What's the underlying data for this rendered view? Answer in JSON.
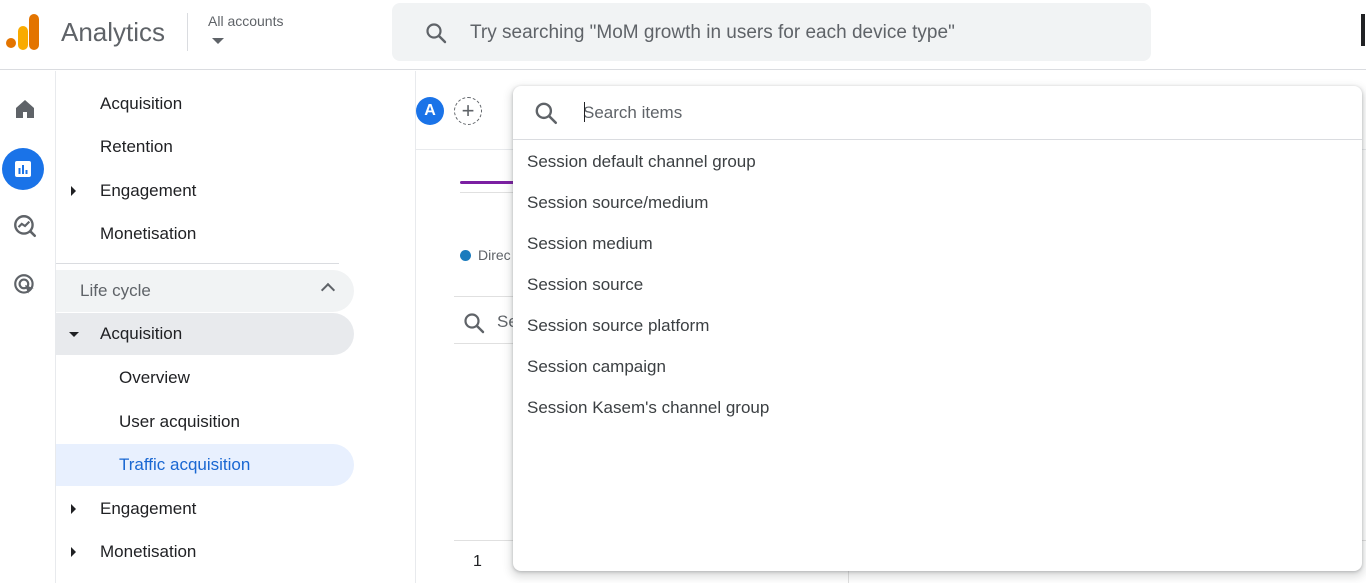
{
  "header": {
    "app_title": "Analytics",
    "accounts_label": "All accounts",
    "search_placeholder": "Try searching \"MoM growth in users for each device type\""
  },
  "sidebar": {
    "items_top": [
      {
        "label": "Acquisition"
      },
      {
        "label": "Retention"
      },
      {
        "label": "Engagement"
      },
      {
        "label": "Monetisation"
      }
    ],
    "lifecycle_label": "Life cycle",
    "lifecycle_acquisition": "Acquisition",
    "sub_items": [
      {
        "label": "Overview"
      },
      {
        "label": "User acquisition"
      },
      {
        "label": "Traffic acquisition"
      }
    ],
    "engagement": "Engagement",
    "monetisation": "Monetisation"
  },
  "main": {
    "segment_avatar": "A",
    "add_symbol": "+",
    "legend_text": "Direc",
    "table_search_text": "Se",
    "row_number": "1"
  },
  "dropdown": {
    "search_placeholder": "Search items",
    "items": [
      "Session default channel group",
      "Session source/medium",
      "Session medium",
      "Session source",
      "Session source platform",
      "Session campaign",
      "Session Kasem's channel group"
    ]
  },
  "icons": {
    "top_search": "search-icon",
    "rail": [
      "home-icon",
      "reports-icon",
      "explore-icon",
      "advertising-icon"
    ],
    "dropdown_search": "search-icon"
  },
  "colors": {
    "accent": "#1a73e8",
    "selected_bg": "#e8f0fe",
    "logo_orange": "#e37400",
    "logo_yellow": "#f9ab00",
    "legend_blue": "#1a7bbd",
    "chart_purple": "#7b1fa2"
  }
}
